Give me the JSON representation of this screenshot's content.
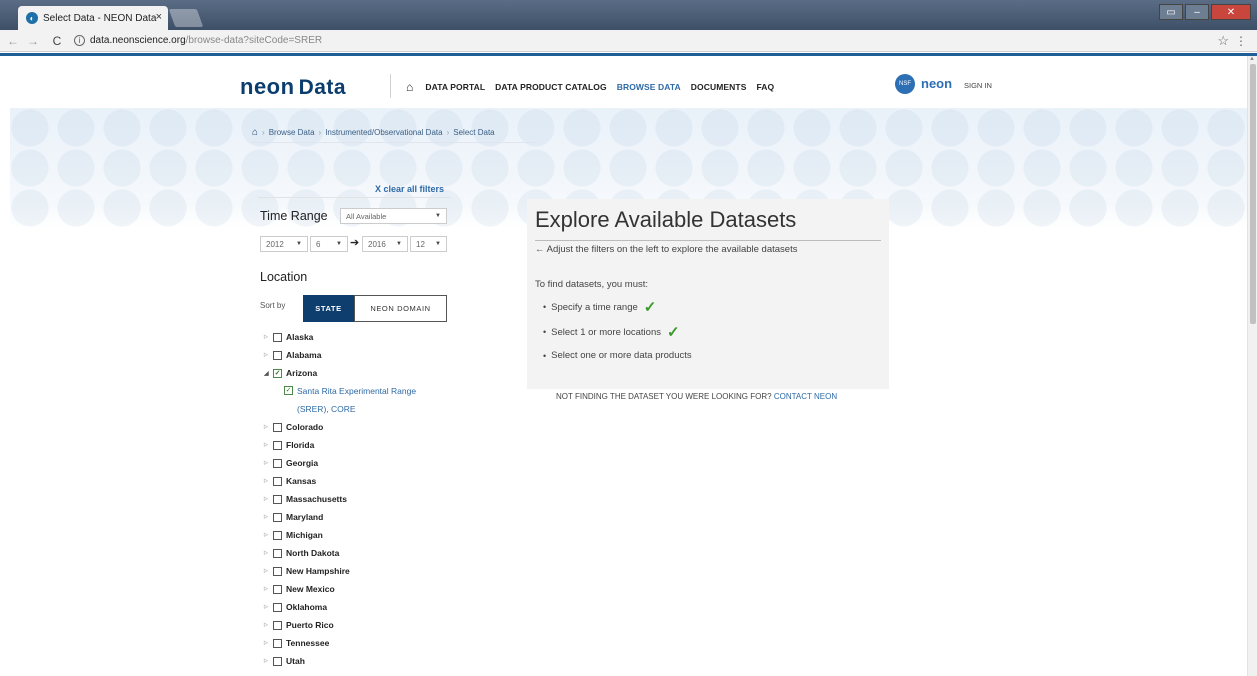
{
  "browser": {
    "tab_title": "Select Data - NEON Data",
    "tab_close": "×",
    "url_host": "data.neonscience.org",
    "url_path": "/browse-data?siteCode=SRER"
  },
  "header": {
    "logo_neon": "neon",
    "logo_data": "Data",
    "nav": {
      "portal": "DATA PORTAL",
      "catalog": "DATA PRODUCT CATALOG",
      "browse": "BROWSE DATA",
      "documents": "DOCUMENTS",
      "faq": "FAQ"
    },
    "nsf_text": "NSF",
    "neon_small": "neon",
    "signin": "SIGN IN"
  },
  "breadcrumb": [
    "Browse Data",
    "Instrumented/Observational Data",
    "Select Data"
  ],
  "filters": {
    "clear": "X clear all filters",
    "time_range_label": "Time Range",
    "time_range_select": "All Available",
    "start_year": "2012",
    "start_month": "6",
    "end_year": "2016",
    "end_month": "12",
    "location_label": "Location",
    "sort_by": "Sort by",
    "sort_state": "STATE",
    "sort_domain": "NEON DOMAIN",
    "states": [
      "Alaska",
      "Alabama",
      "Arizona",
      "Colorado",
      "Florida",
      "Georgia",
      "Kansas",
      "Massachusetts",
      "Maryland",
      "Michigan",
      "North Dakota",
      "New Hampshire",
      "New Mexico",
      "Oklahoma",
      "Puerto Rico",
      "Tennessee",
      "Utah"
    ],
    "site": "Santa Rita Experimental Range (SRER), CORE"
  },
  "main": {
    "title": "Explore Available Datasets",
    "subtitle": "← Adjust the filters on the left to explore the available datasets",
    "must": "To find datasets, you must:",
    "req1": "Specify a time range",
    "req2": "Select 1 or more locations",
    "req3": "Select one or more data products",
    "not_finding": "NOT FINDING THE DATASET YOU WERE LOOKING FOR?",
    "contact": "CONTACT NEON"
  },
  "colors": {
    "navy": "#0e3e6e",
    "link": "#2e6aa6",
    "check": "#3a9a2a"
  }
}
